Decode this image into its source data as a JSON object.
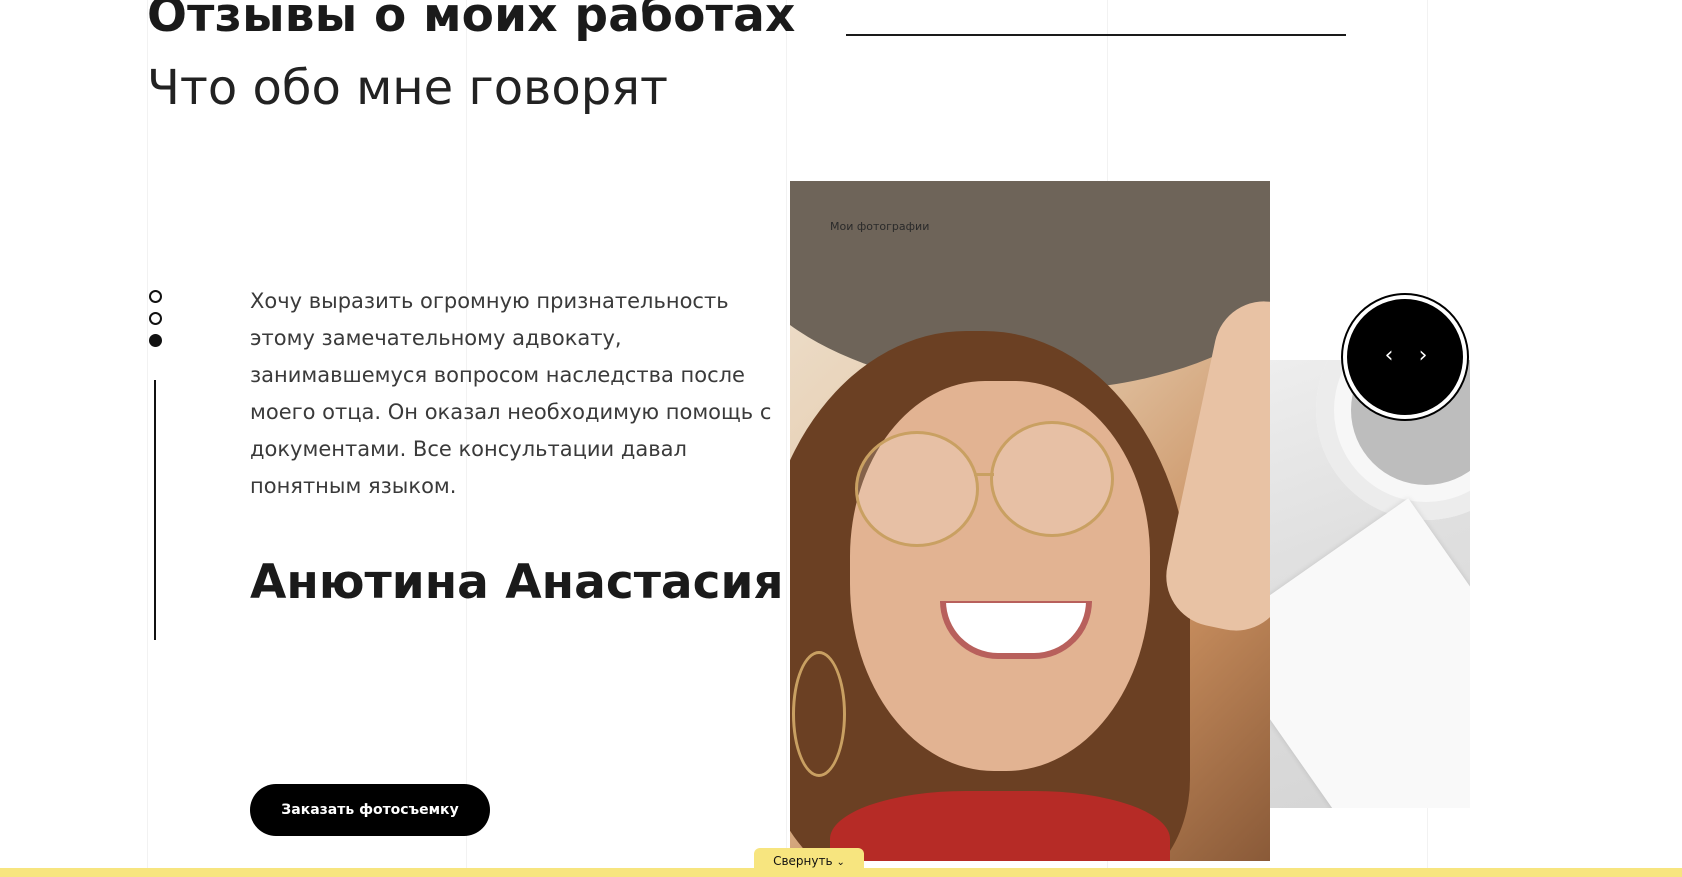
{
  "section": {
    "title": "Отзывы о моих работах",
    "subtitle": "Что обо мне говорят"
  },
  "review": {
    "text": "Хочу выразить огромную признательность этому замечательному адвокату, занимавшемуся вопросом наследства после моего отца. Он оказал необходимую помощь с документами. Все консультации давал понятным языком.",
    "author": "Анютина Анастасия",
    "active_dot_index": 2,
    "dot_count": 3
  },
  "photo": {
    "caption": "Мои фотографии"
  },
  "nav": {
    "prev_icon": "chevron-left-icon",
    "next_icon": "chevron-right-icon",
    "prev_glyph": "‹",
    "next_glyph": "›"
  },
  "cta": {
    "order_label": "Заказать фотосъемку"
  },
  "footer_tab": {
    "label": "Свернуть",
    "icon": "chevron-down-icon",
    "glyph": "⌄"
  },
  "colors": {
    "accent_yellow": "#f7e57f",
    "button_black": "#000000",
    "text_dark": "#1a1a1a"
  }
}
